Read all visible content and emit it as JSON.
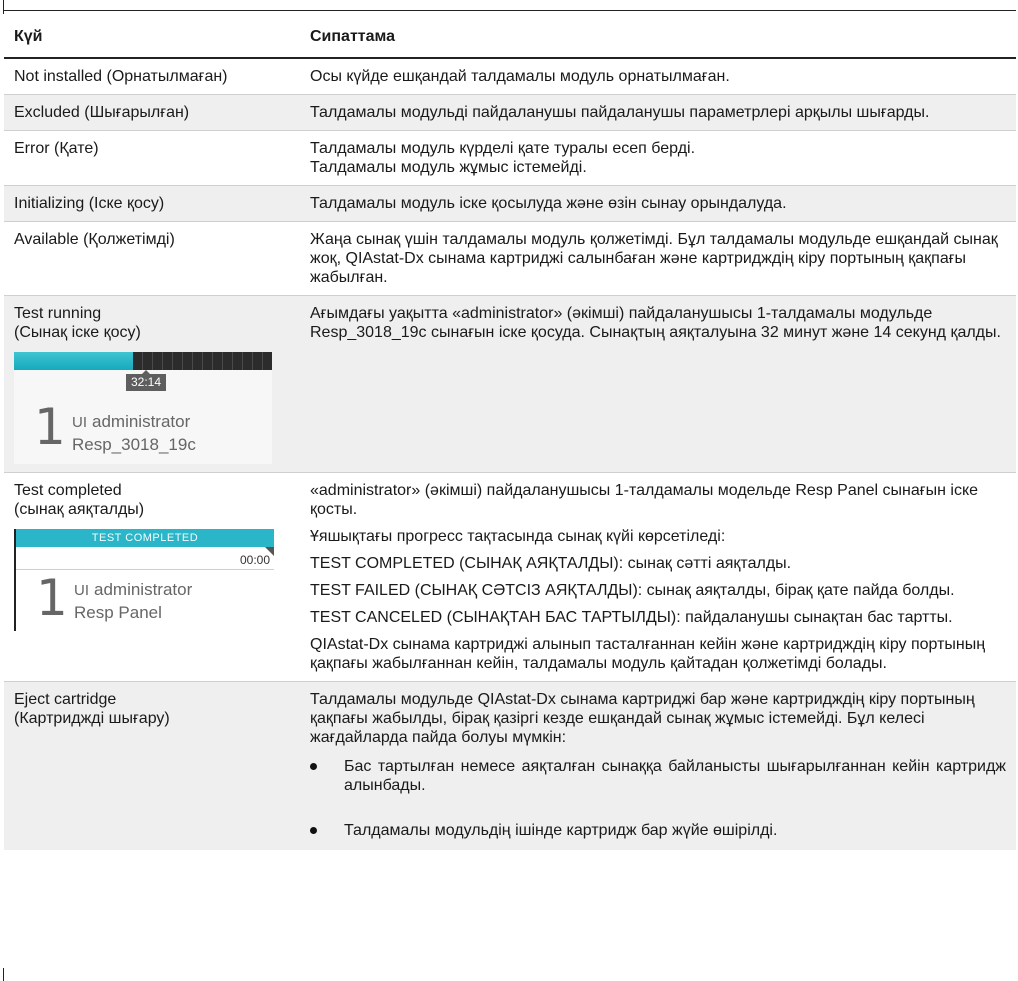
{
  "table": {
    "headers": [
      "Күй",
      "Сипаттама"
    ],
    "rows": [
      {
        "state": "Not installed (Орнатылмаған)",
        "desc": [
          "Осы күйде ешқандай талдамалы модуль орнатылмаған."
        ]
      },
      {
        "state": "Excluded (Шығарылған)",
        "desc": [
          "Талдамалы модульді пайдаланушы пайдаланушы параметрлері арқылы шығарды."
        ]
      },
      {
        "state": "Error (Қате)",
        "desc": [
          "Талдамалы модуль күрделі қате туралы есеп берді.\nТалдамалы модуль жұмыс істемейді."
        ]
      },
      {
        "state": "Initializing (Іске қосу)",
        "desc": [
          "Талдамалы модуль іске қосылуда және өзін сынау орындалуда."
        ]
      },
      {
        "state": "Available (Қолжетімді)",
        "desc": [
          "Жаңа сынақ үшін талдамалы модуль қолжетімді. Бұл талдамалы модульде ешқандай сынақ жоқ, QIAstat-Dx сынама картриджі салынбаған және картридждің кіру портының қақпағы жабылған."
        ]
      },
      {
        "state": "Test running\n(Сынақ іске қосу)",
        "desc": [
          "Ағымдағы уақытта «administrator» (әкімші) пайдаланушысы 1-талдамалы модульде Resp_3018_19c сынағын іске қосуда. Сынақтың аяқталуына 32 минут және 14 секунд қалды."
        ]
      },
      {
        "state": "Test completed\n(сынақ аяқталды)",
        "desc": [
          "«administrator» (әкімші) пайдаланушысы 1-талдамалы модельде Resp Panel сынағын іске қосты.",
          "Ұяшықтағы прогресс тақтасында сынақ күйі көрсетіледі:",
          "TEST COMPLETED (СЫНАҚ АЯҚТАЛДЫ): сынақ сәтті аяқталды.",
          "TEST FAILED (СЫНАҚ СӘТСІЗ АЯҚТАЛДЫ): сынақ аяқталды, бірақ қате пайда болды.",
          "TEST CANCELED (СЫНАҚТАН БАС ТАРТЫЛДЫ): пайдаланушы сынақтан бас тартты.",
          "QIAstat-Dx сынама картриджі алынып тасталғаннан кейін және картридждің кіру портының қақпағы жабылғаннан кейін, талдамалы модуль қайтадан қолжетімді болады."
        ]
      },
      {
        "state": "Eject cartridge\n(Картриджді шығару)",
        "desc": [
          "Талдамалы модульде QIAstat-Dx сынама картриджі бар және картридждің кіру портының қақпағы жабылды, бірақ қазіргі кезде ешқандай сынақ жұмыс істемейді. Бұл келесі жағдайларда пайда болуы мүмкін:"
        ],
        "bullets": [
          "Бас тартылған немесе аяқталған сынаққа байланысты шығарылғаннан кейін картридж алынбады.",
          "Талдамалы модульдің ішінде картридж бар жүйе өшірілді."
        ]
      }
    ]
  },
  "thumb_running": {
    "time": "32:14",
    "module_number": "1",
    "ui_label": "UI",
    "user": "administrator",
    "test": "Resp_3018_19c",
    "progress": 0.46
  },
  "thumb_completed": {
    "status": "TEST COMPLETED",
    "time": "00:00",
    "module_number": "1",
    "ui_label": "UI",
    "user": "administrator",
    "test": "Resp Panel"
  },
  "colors": {
    "shade": "#efefef",
    "accent": "#2ab6c8"
  }
}
